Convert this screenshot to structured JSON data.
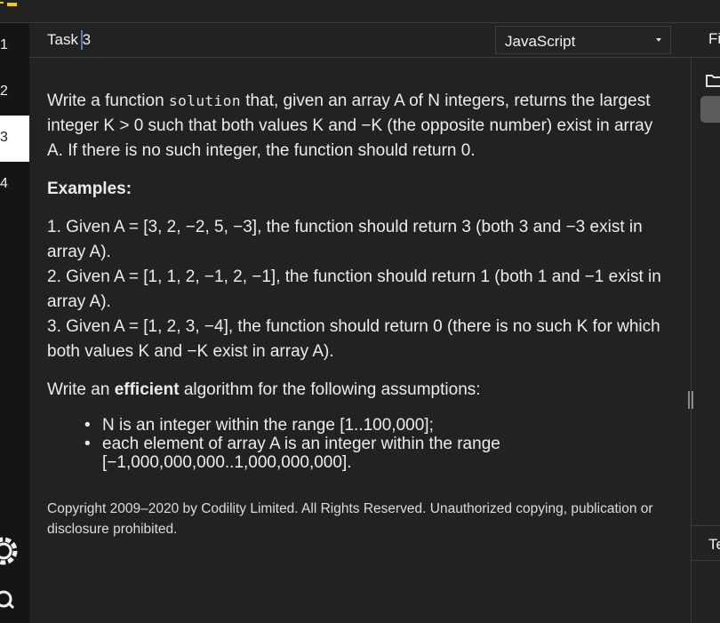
{
  "sidebar": {
    "steps": [
      {
        "label": "1"
      },
      {
        "label": "2"
      },
      {
        "label": "3"
      },
      {
        "label": "4"
      }
    ],
    "icons": [
      "settings-icon",
      "chat-help-icon"
    ]
  },
  "header": {
    "task_title": "Task 3",
    "language": "JavaScript"
  },
  "task": {
    "intro_a": "Write a function ",
    "fn_name": "solution",
    "intro_b": " that, given an array A of N integers, returns the largest integer K > 0 such that both values K and −K (the opposite number) exist in array A. If there is no such integer, the function should return 0.",
    "examples_heading": "Examples:",
    "examples": [
      "1. Given A = [3, 2, −2, 5, −3], the function should return 3 (both 3 and −3 exist in array A).",
      "2. Given A = [1, 1, 2, −1, 2, −1], the function should return 1 (both 1 and −1 exist in array A).",
      "3. Given A = [1, 2, 3, −4], the function should return 0 (there is no such K for which both values K and −K exist in array A)."
    ],
    "assume_a": "Write an ",
    "assume_bold": "efficient",
    "assume_b": " algorithm for the following assumptions:",
    "assumptions": [
      "N is an integer within the range [1..100,000];",
      "each element of array A is an integer within the range [−1,000,000,000..1,000,000,000]."
    ],
    "copyright": "Copyright 2009–2020 by Codility Limited. All Rights Reserved. Unauthorized copying, publication or disclosure prohibited."
  },
  "right_panel": {
    "top_label": "Fi",
    "bottom_label": "Te"
  },
  "colors": {
    "accent": "#f2cb05",
    "background": "#222220",
    "sidebar": "#151514"
  }
}
